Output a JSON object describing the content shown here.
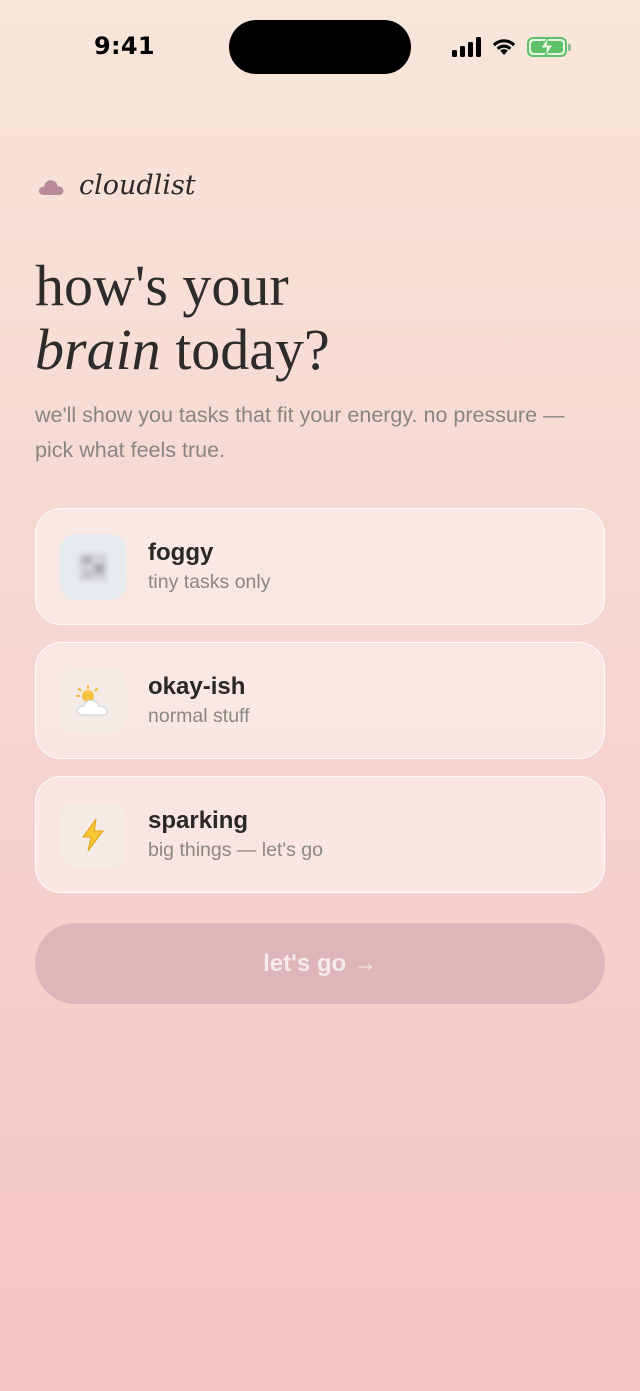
{
  "status_bar": {
    "time": "9:41",
    "icons": [
      "signal-icon",
      "wifi-icon",
      "battery-charging-icon"
    ]
  },
  "brand": {
    "name": "cloudlist",
    "icon": "cloud-icon",
    "icon_color": "#b98a9a"
  },
  "headline": {
    "line1": "how's your",
    "line2_italic": "brain",
    "line2_rest": " today?"
  },
  "subtitle": "we'll show you tasks that fit your energy. no pressure — pick what feels true.",
  "options": [
    {
      "title": "foggy",
      "description": "tiny tasks only",
      "icon": "fog-icon"
    },
    {
      "title": "okay-ish",
      "description": "normal stuff",
      "icon": "sun-behind-cloud-icon"
    },
    {
      "title": "sparking",
      "description": "big things — let's go",
      "icon": "lightning-icon"
    }
  ],
  "cta": {
    "label": "let's go →",
    "disabled": true
  },
  "colors": {
    "background_top": "#f8e6da",
    "background_bottom": "#f3c5c5",
    "cta_background": "#ddb5ba",
    "battery_green": "#5dc269"
  }
}
